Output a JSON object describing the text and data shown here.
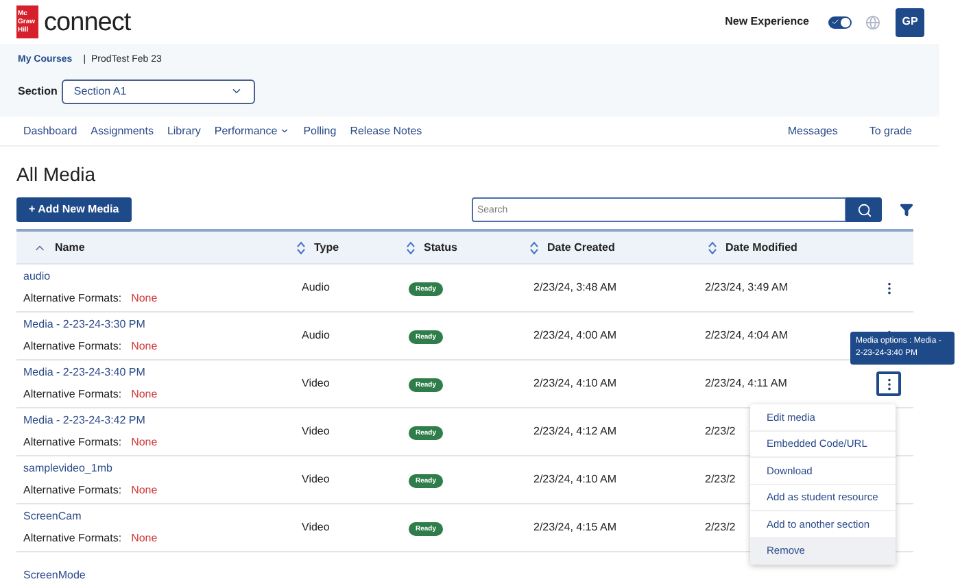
{
  "header": {
    "brand": "connect",
    "logo_lines": [
      "Mc",
      "Graw",
      "Hill"
    ],
    "new_experience": {
      "label": "New Experience",
      "on": true
    },
    "avatar": "GP"
  },
  "breadcrumb": {
    "link": "My Courses",
    "separator": "|",
    "current": "ProdTest Feb 23"
  },
  "section": {
    "label": "Section",
    "value": "Section A1"
  },
  "nav": {
    "items": [
      {
        "label": "Dashboard",
        "has_caret": false
      },
      {
        "label": "Assignments",
        "has_caret": false
      },
      {
        "label": "Library",
        "has_caret": false
      },
      {
        "label": "Performance",
        "has_caret": true
      },
      {
        "label": "Polling",
        "has_caret": false
      },
      {
        "label": "Release Notes",
        "has_caret": false
      }
    ],
    "right_items": [
      "Messages",
      "To grade"
    ]
  },
  "page_title": "All Media",
  "add_button": "+ Add New Media",
  "search": {
    "placeholder": "Search"
  },
  "table": {
    "columns": [
      {
        "label": "Name",
        "sorted": true
      },
      {
        "label": "Type",
        "sorted": false
      },
      {
        "label": "Status",
        "sorted": false
      },
      {
        "label": "Date Created",
        "sorted": false
      },
      {
        "label": "Date Modified",
        "sorted": false
      }
    ],
    "rows": [
      {
        "name": "audio",
        "alt_label": "Alternative Formats:",
        "alt_value": "None",
        "type": "Audio",
        "status": "Ready",
        "date_created": "2/23/24, 3:48 AM",
        "date_modified": "2/23/24, 3:49 AM",
        "menu_open": false
      },
      {
        "name": "Media - 2-23-24-3:30 PM",
        "alt_label": "Alternative Formats:",
        "alt_value": "None",
        "type": "Audio",
        "status": "Ready",
        "date_created": "2/23/24, 4:00 AM",
        "date_modified": "2/23/24, 4:04 AM",
        "menu_open": false
      },
      {
        "name": "Media - 2-23-24-3:40 PM",
        "alt_label": "Alternative Formats:",
        "alt_value": "None",
        "type": "Video",
        "status": "Ready",
        "date_created": "2/23/24, 4:10 AM",
        "date_modified": "2/23/24, 4:11 AM",
        "menu_open": true
      },
      {
        "name": "Media - 2-23-24-3:42 PM",
        "alt_label": "Alternative Formats:",
        "alt_value": "None",
        "type": "Video",
        "status": "Ready",
        "date_created": "2/23/24, 4:12 AM",
        "date_modified": "2/23/2"
      },
      {
        "name": "samplevideo_1mb",
        "alt_label": "Alternative Formats:",
        "alt_value": "None",
        "type": "Video",
        "status": "Ready",
        "date_created": "2/23/24, 4:10 AM",
        "date_modified": "2/23/2"
      },
      {
        "name": "ScreenCam",
        "alt_label": "Alternative Formats:",
        "alt_value": "None",
        "type": "Video",
        "status": "Ready",
        "date_created": "2/23/24, 4:15 AM",
        "date_modified": "2/23/2"
      },
      {
        "name": "ScreenMode"
      }
    ]
  },
  "tooltip": "Media options : Media - 2-23-24-3:40 PM",
  "menu": [
    {
      "label": "Edit media",
      "highlighted": false
    },
    {
      "label": "Embedded Code/URL",
      "highlighted": false
    },
    {
      "label": "Download",
      "highlighted": false
    },
    {
      "label": "Add as student resource",
      "highlighted": false
    },
    {
      "label": "Add to another section",
      "highlighted": false
    },
    {
      "label": "Remove",
      "highlighted": true
    }
  ]
}
